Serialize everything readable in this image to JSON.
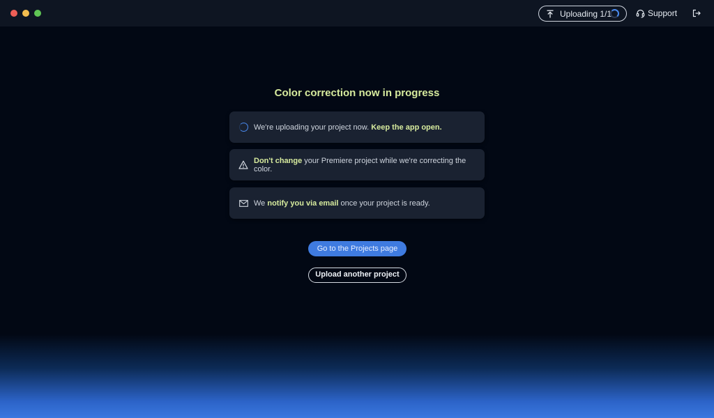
{
  "titlebar": {
    "upload_status": "Uploading 1/1",
    "support_label": "Support"
  },
  "main": {
    "heading": "Color correction now in progress",
    "cards": [
      {
        "icon": "loading-spinner-icon",
        "prefix": "We're uploading your project now. ",
        "highlight": "Keep the app open.",
        "suffix": ""
      },
      {
        "icon": "warning-triangle-icon",
        "prefix": "",
        "highlight": "Don't change",
        "suffix": " your Premiere project while we're correcting the color."
      },
      {
        "icon": "mail-icon",
        "prefix": "We ",
        "highlight": "notify you via email",
        "suffix": " once your project is ready."
      }
    ],
    "primary_button": "Go to the Projects page",
    "secondary_button": "Upload another project"
  },
  "colors": {
    "accent": "#3f7be0",
    "highlight": "#d7eb9e",
    "card_bg": "#1a2231",
    "background": "#020814"
  }
}
